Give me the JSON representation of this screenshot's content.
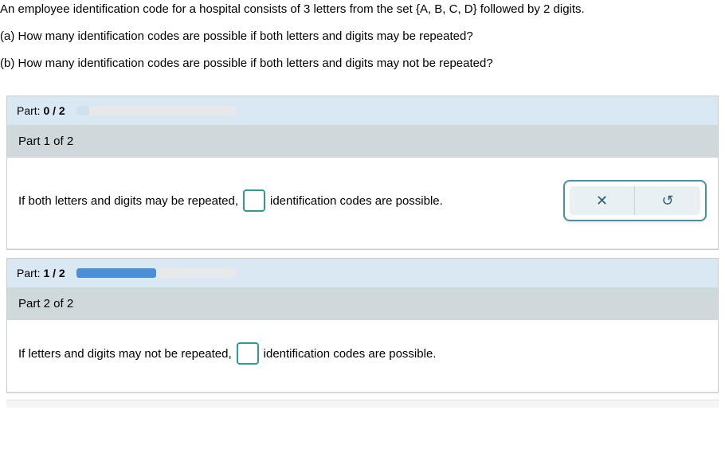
{
  "problem": {
    "intro": "An employee identification code for a hospital consists of 3 letters from the set {A, B, C, D} followed by 2 digits.",
    "question_a": "(a) How many identification codes are possible if both letters and digits may be repeated?",
    "question_b": "(b) How many identification codes are possible if both letters and digits may not be repeated?"
  },
  "parts": [
    {
      "progress_label_prefix": "Part: ",
      "progress_label_value": "0 / 2",
      "title": "Part 1 of 2",
      "sentence_before": "If both letters and digits may be repeated,",
      "sentence_after": "identification codes are possible.",
      "show_toolbar": true
    },
    {
      "progress_label_prefix": "Part: ",
      "progress_label_value": "1 / 2",
      "title": "Part 2 of 2",
      "sentence_before": "If letters and digits may not be repeated,",
      "sentence_after": "identification codes are possible.",
      "show_toolbar": false
    }
  ],
  "toolbar": {
    "clear_icon": "✕",
    "reset_icon": "↺"
  }
}
